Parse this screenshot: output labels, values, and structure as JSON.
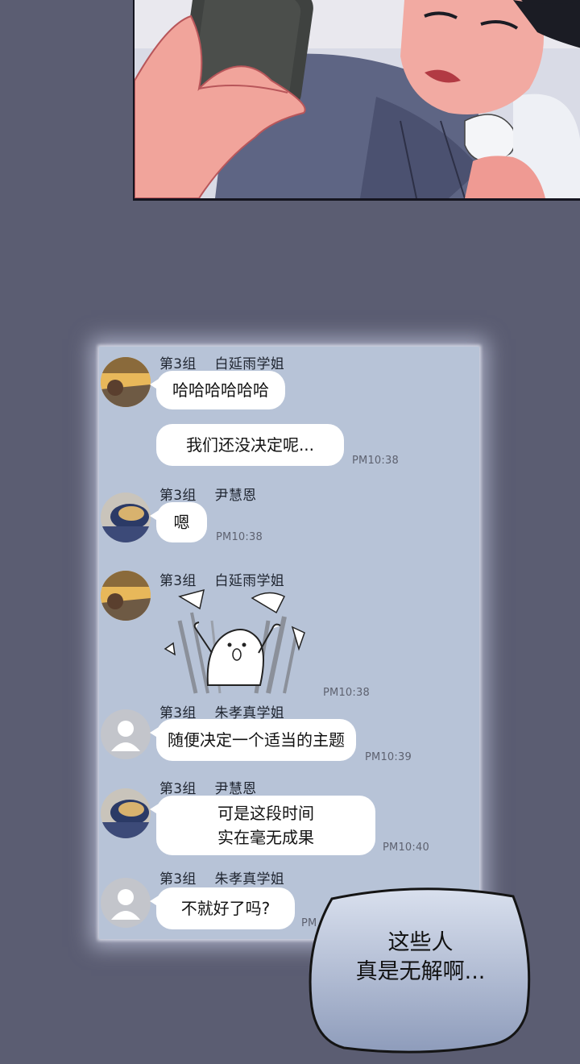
{
  "chat": {
    "messages": [
      {
        "sender_group": "第3组",
        "sender_name": "白延雨学姐",
        "bubbles": [
          "哈哈哈哈哈哈",
          "我们还没决定呢..."
        ],
        "time": "PM10:38"
      },
      {
        "sender_group": "第3组",
        "sender_name": "尹慧恩",
        "bubbles": [
          "嗯"
        ],
        "time": "PM10:38"
      },
      {
        "sender_group": "第3组",
        "sender_name": "白延雨学姐",
        "sticker": "cheering-ghost-sticker",
        "time": "PM10:38"
      },
      {
        "sender_group": "第3组",
        "sender_name": "朱孝真学姐",
        "bubbles": [
          "随便决定一个适当的主题"
        ],
        "time": "PM10:39"
      },
      {
        "sender_group": "第3组",
        "sender_name": "尹慧恩",
        "bubble_lines": [
          "可是这段时间",
          "实在毫无成果"
        ],
        "time": "PM10:40"
      },
      {
        "sender_group": "第3组",
        "sender_name": "朱孝真学姐",
        "bubbles": [
          "不就好了吗?"
        ],
        "time": "PM"
      }
    ]
  },
  "narration": {
    "lines": [
      "这些人",
      "真是无解啊..."
    ]
  },
  "colors": {
    "page_background": "#5b5d72",
    "chat_background": "#b7c3d7",
    "bubble": "#ffffff",
    "narration_top": "#d9e0ee",
    "narration_bottom": "#8e9cbb"
  }
}
